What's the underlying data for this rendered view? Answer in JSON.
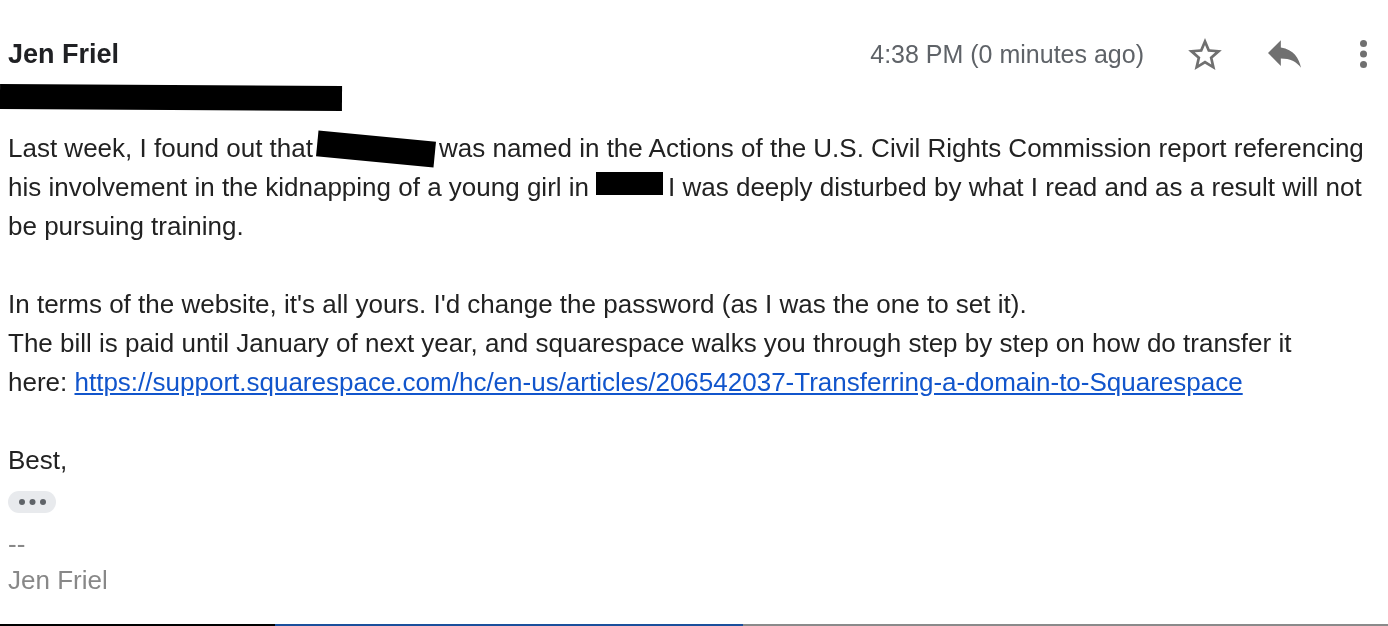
{
  "sender": {
    "name": "Jen Friel",
    "address_redacted": true
  },
  "header": {
    "timestamp": "4:38 PM (0 minutes ago)",
    "starred": false
  },
  "paragraphs": [
    {
      "lines": [
        {
          "kind": "wrapped",
          "segments": [
            {
              "kind": "text",
              "text": "Last week, I found out that"
            },
            {
              "kind": "redaction"
            },
            {
              "kind": "text",
              "text": "was named in the Actions of the U.S. Civil Rights Commission report referencing his involvement in the kidnapping of a young girl in"
            },
            {
              "kind": "redaction"
            },
            {
              "kind": "text",
              "text": "I was deeply disturbed by what I read and as a result will not be pursuing training."
            }
          ]
        }
      ]
    },
    {
      "lines": [
        {
          "kind": "text",
          "text": "In terms of the website, it's all yours. I'd change the password (as I was the one to set it)."
        },
        {
          "kind": "text",
          "text": "The bill is paid until January of next year, and squarespace walks you through step by step on how do transfer it"
        },
        {
          "kind": "link",
          "text": "here:",
          "url": "https://support.squarespace.com/hc/en-us/articles/206542037-Transferring-a-domain-to-Squarespace"
        }
      ]
    },
    {
      "lines": [
        {
          "kind": "text",
          "text": "Best,"
        }
      ]
    }
  ],
  "signature": {
    "separator": "--",
    "name": "Jen Friel"
  }
}
